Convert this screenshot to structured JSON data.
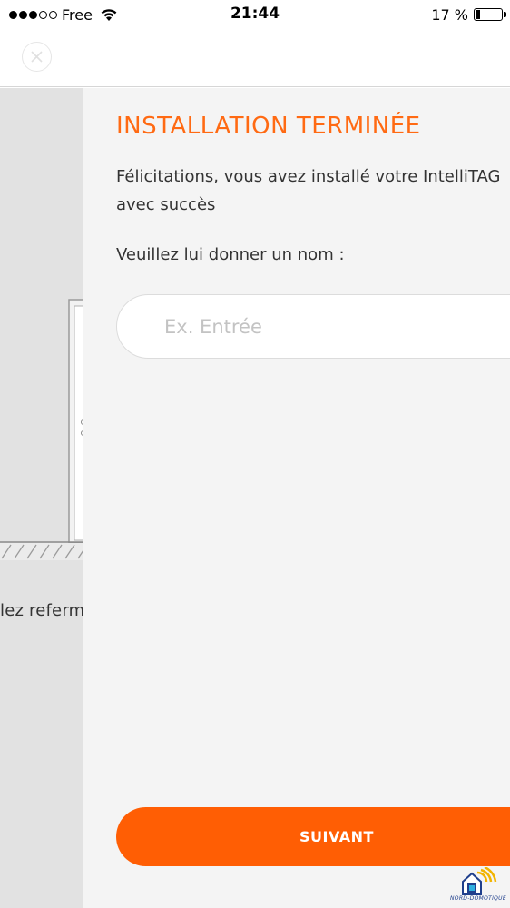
{
  "status_bar": {
    "carrier": "Free",
    "time": "21:44",
    "battery_percent": "17 %",
    "battery_level": 0.17
  },
  "header": {
    "close_icon": "close-icon"
  },
  "background_step": {
    "instruction_fragment": "lez referm"
  },
  "panel": {
    "title": "INSTALLATION TERMINÉE",
    "description": "Félicitations, vous avez installé votre IntelliTAG avec succès",
    "prompt": "Veuillez lui donner un nom :",
    "name_input": {
      "value": "",
      "placeholder": "Ex. Entrée"
    },
    "next_button_label": "SUIVANT"
  },
  "watermark": {
    "text": "NORD-DOMOTIQUE"
  },
  "colors": {
    "accent": "#ff5e04",
    "title": "#ff6a13",
    "panel_bg": "#f4f4f4",
    "underlay_bg": "#e2e2e2"
  }
}
